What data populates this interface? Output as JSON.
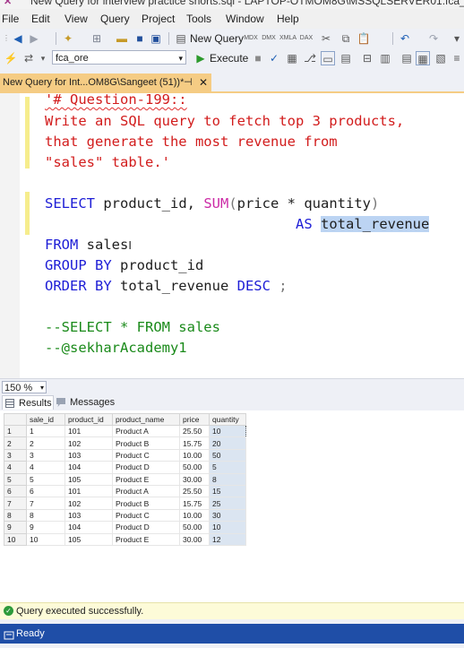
{
  "title_bar": {
    "text": "New Query for interview practice shorts.sql - LAPTOP-OTMOM8G\\MSSQLSERVER01.fca_ore (LAPTOP-O"
  },
  "menu": [
    "File",
    "Edit",
    "View",
    "Query",
    "Project",
    "Tools",
    "Window",
    "Help"
  ],
  "toolbar": {
    "new_query_label": "New Query",
    "database": "fca_ore",
    "execute_label": "Execute"
  },
  "document_tab": {
    "label": "New Query for Int...OM8G\\Sangeet (51))*"
  },
  "editor": {
    "comment_lines": [
      "'# Question-199::",
      "Write an SQL query to fetch top 3 products,",
      "that generate the most revenue from",
      "\"sales\" table.'"
    ],
    "select_kw": "SELECT",
    "select_col": " product_id, ",
    "sum_fn": "SUM",
    "sum_open": "(",
    "sum_expr": "price * quantity",
    "sum_close": ")",
    "as_kw": "AS",
    "alias": "total_revenue",
    "from_kw": "FROM",
    "from_table": " sales",
    "group_kw": "GROUP BY",
    "group_col": " product_id",
    "order_kw": "ORDER BY",
    "order_col": " total_revenue ",
    "desc_kw": "DESC",
    "terminator": " ;",
    "line_comment_1": "--SELECT * FROM sales",
    "line_comment_2": "--@sekharAcademy1"
  },
  "zoom": "150 %",
  "results_tabs": {
    "results": "Results",
    "messages": "Messages"
  },
  "grid": {
    "columns": [
      "sale_id",
      "product_id",
      "product_name",
      "price",
      "quantity"
    ],
    "rows": [
      [
        "1",
        "1",
        "101",
        "Product A",
        "25.50",
        "10"
      ],
      [
        "2",
        "2",
        "102",
        "Product B",
        "15.75",
        "20"
      ],
      [
        "3",
        "3",
        "103",
        "Product C",
        "10.00",
        "50"
      ],
      [
        "4",
        "4",
        "104",
        "Product D",
        "50.00",
        "5"
      ],
      [
        "5",
        "5",
        "105",
        "Product E",
        "30.00",
        "8"
      ],
      [
        "6",
        "6",
        "101",
        "Product A",
        "25.50",
        "15"
      ],
      [
        "7",
        "7",
        "102",
        "Product B",
        "15.75",
        "25"
      ],
      [
        "8",
        "8",
        "103",
        "Product C",
        "10.00",
        "30"
      ],
      [
        "9",
        "9",
        "104",
        "Product D",
        "50.00",
        "10"
      ],
      [
        "10",
        "10",
        "105",
        "Product E",
        "30.00",
        "12"
      ]
    ]
  },
  "query_status": "Query executed successfully.",
  "status_bar": "Ready",
  "colors": {
    "comment": "#d21c1c",
    "keyword": "#1d1dd6",
    "function": "#cc2ba6",
    "line_comment": "#1a8a1a",
    "tab_active": "#f5cc84",
    "status_bar": "#1f4ea7"
  }
}
